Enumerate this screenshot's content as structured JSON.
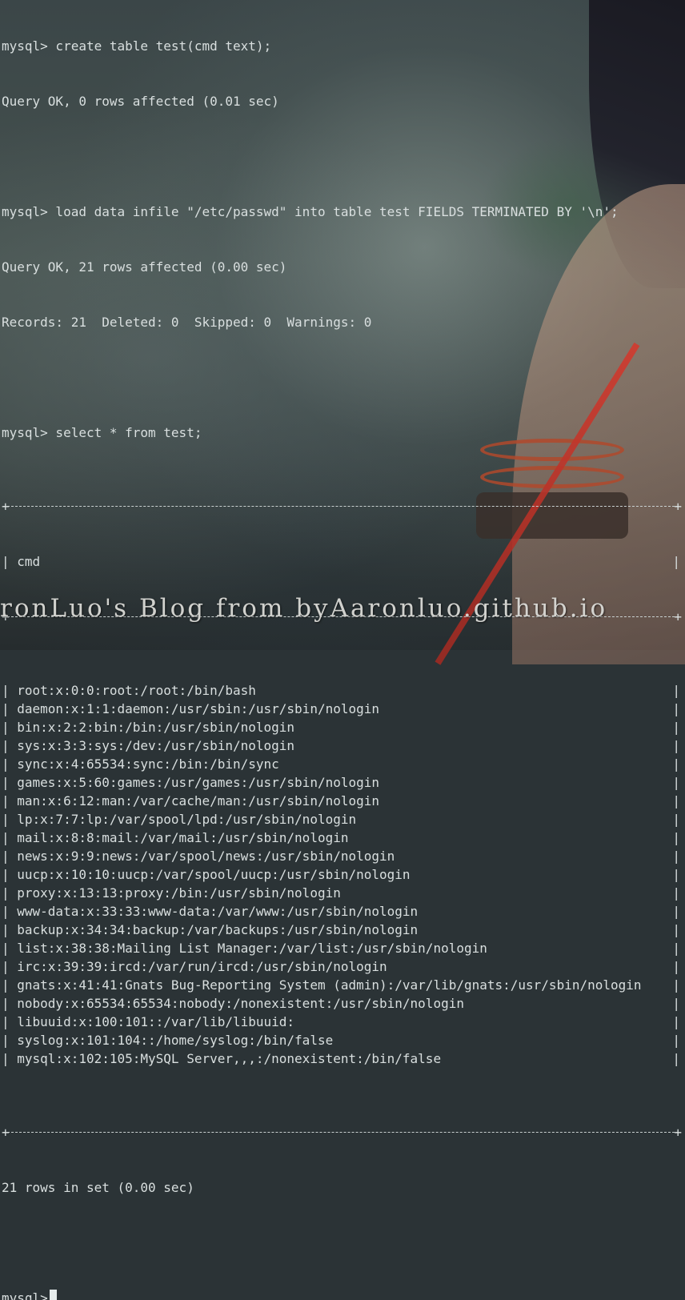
{
  "terminal": {
    "lines_top": [
      "mysql> create table test(cmd text);",
      "Query OK, 0 rows affected (0.01 sec)",
      "",
      "mysql> load data infile \"/etc/passwd\" into table test FIELDS TERMINATED BY '\\n';",
      "Query OK, 21 rows affected (0.00 sec)",
      "Records: 21  Deleted: 0  Skipped: 0  Warnings: 0",
      "",
      "mysql> select * from test;"
    ],
    "table": {
      "header": "| cmd",
      "rows": [
        "| root:x:0:0:root:/root:/bin/bash",
        "| daemon:x:1:1:daemon:/usr/sbin:/usr/sbin/nologin",
        "| bin:x:2:2:bin:/bin:/usr/sbin/nologin",
        "| sys:x:3:3:sys:/dev:/usr/sbin/nologin",
        "| sync:x:4:65534:sync:/bin:/bin/sync",
        "| games:x:5:60:games:/usr/games:/usr/sbin/nologin",
        "| man:x:6:12:man:/var/cache/man:/usr/sbin/nologin",
        "| lp:x:7:7:lp:/var/spool/lpd:/usr/sbin/nologin",
        "| mail:x:8:8:mail:/var/mail:/usr/sbin/nologin",
        "| news:x:9:9:news:/var/spool/news:/usr/sbin/nologin",
        "| uucp:x:10:10:uucp:/var/spool/uucp:/usr/sbin/nologin",
        "| proxy:x:13:13:proxy:/bin:/usr/sbin/nologin",
        "| www-data:x:33:33:www-data:/var/www:/usr/sbin/nologin",
        "| backup:x:34:34:backup:/var/backups:/usr/sbin/nologin",
        "| list:x:38:38:Mailing List Manager:/var/list:/usr/sbin/nologin",
        "| irc:x:39:39:ircd:/var/run/ircd:/usr/sbin/nologin",
        "| gnats:x:41:41:Gnats Bug-Reporting System (admin):/var/lib/gnats:/usr/sbin/nologin",
        "| nobody:x:65534:65534:nobody:/nonexistent:/usr/sbin/nologin",
        "| libuuid:x:100:101::/var/lib/libuuid:",
        "| syslog:x:101:104::/home/syslog:/bin/false",
        "| mysql:x:102:105:MySQL Server,,,:/nonexistent:/bin/false"
      ],
      "right_border": "|",
      "corner": "+"
    },
    "summary": "21 rows in set (0.00 sec)",
    "prompt": "mysql>"
  },
  "watermark": {
    "text": "ronLuo's Blog from byAaronluo.github.io"
  },
  "colors": {
    "text": "#d9dfdf",
    "background": "#2b3336"
  }
}
